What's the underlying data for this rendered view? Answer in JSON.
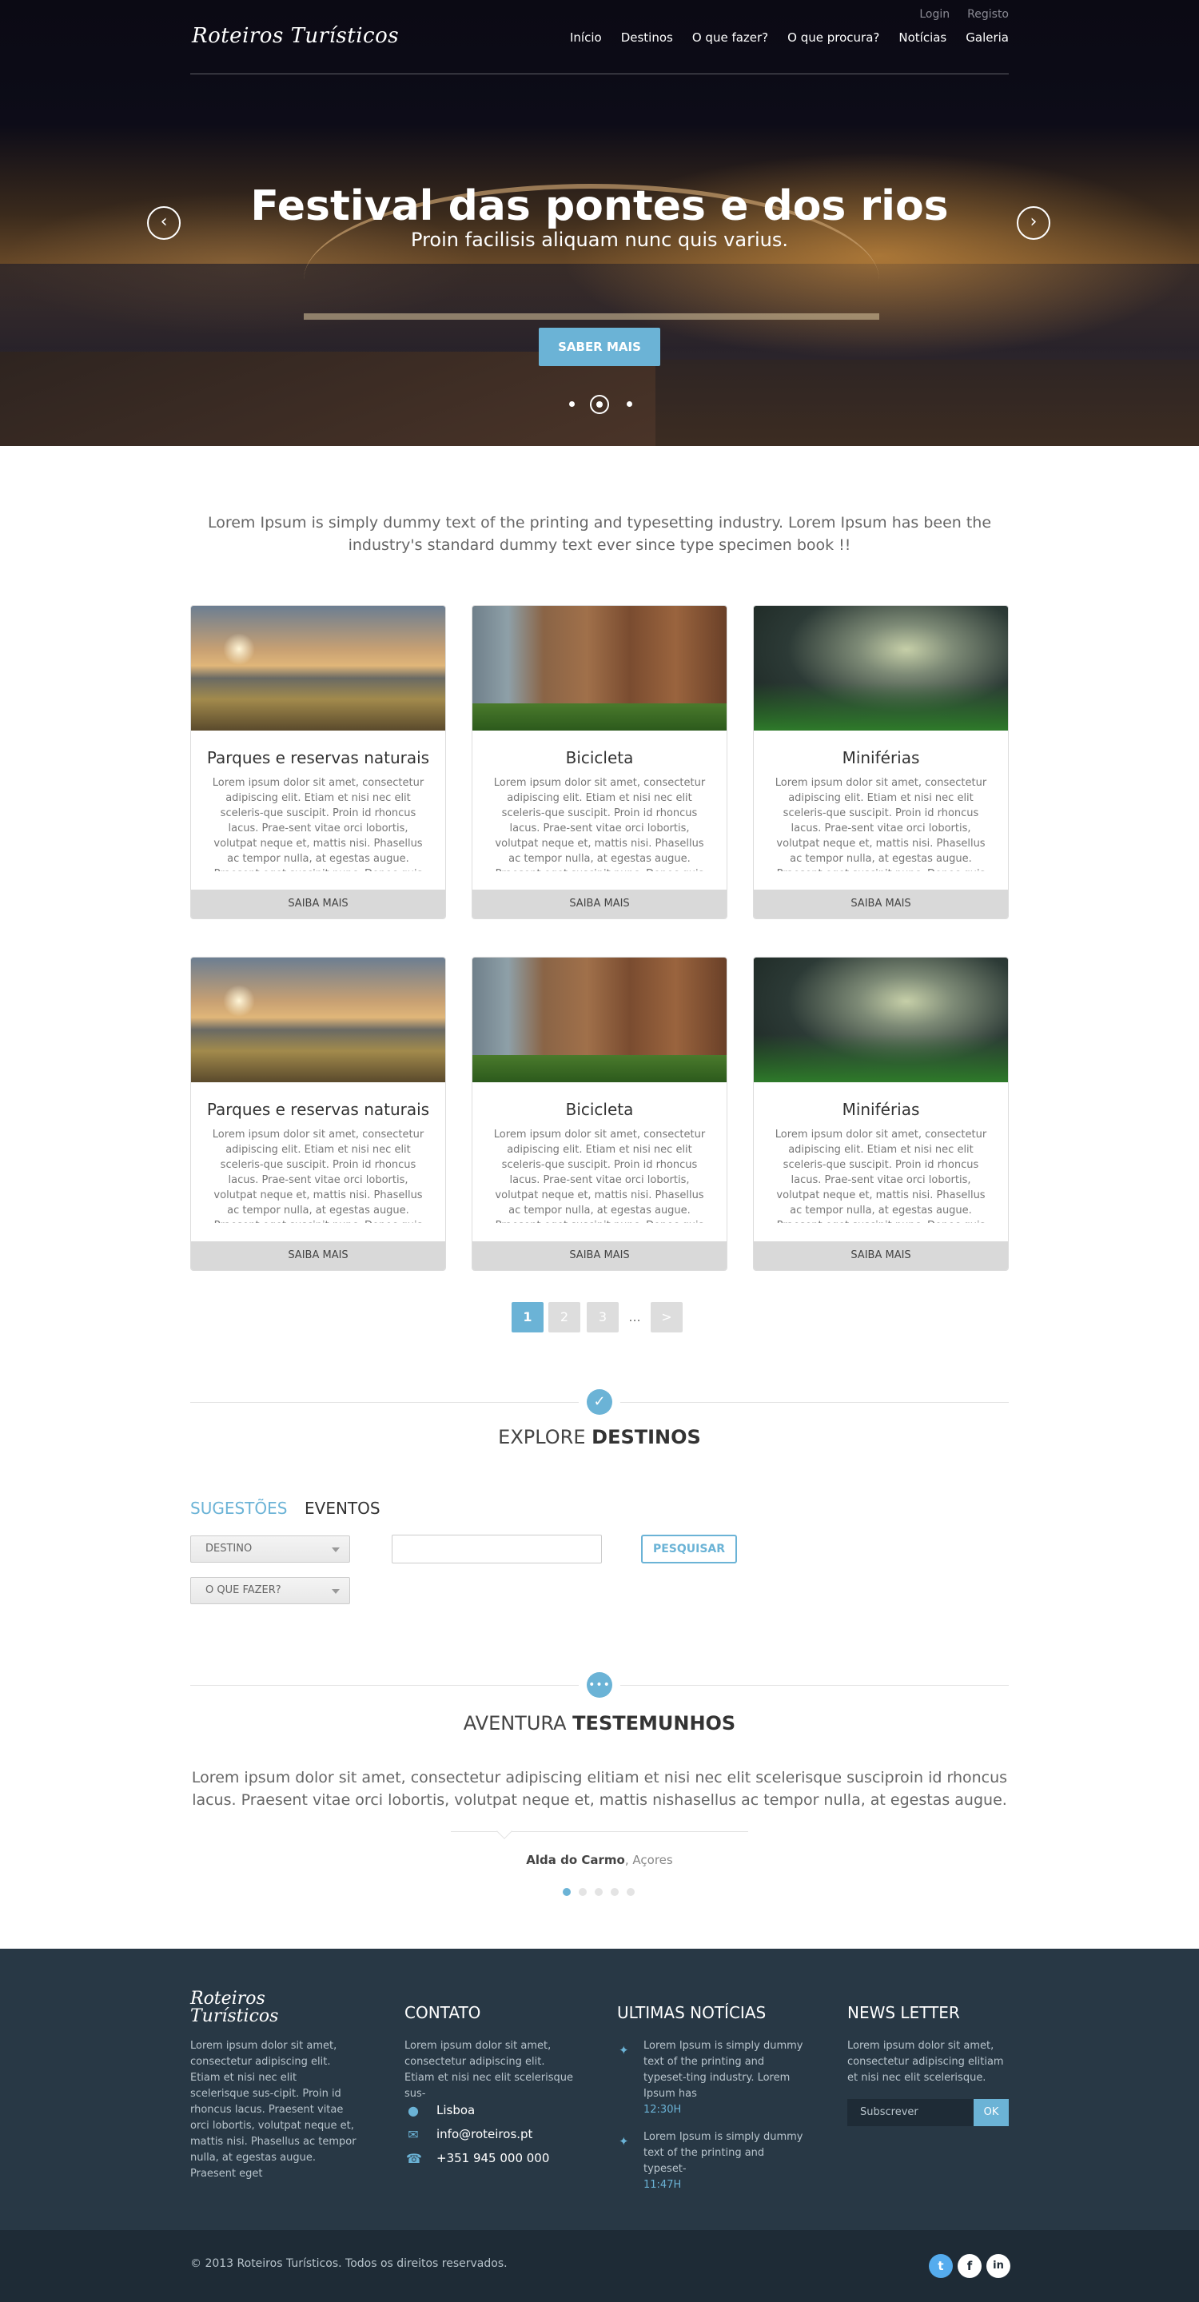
{
  "header": {
    "logo": "Roteiros Turísticos",
    "top_links": [
      "Login",
      "Registo"
    ],
    "nav": [
      "Início",
      "Destinos",
      "O que fazer?",
      "O que procura?",
      "Notícias",
      "Galeria"
    ]
  },
  "hero": {
    "title": "Festival das pontes e dos rios",
    "subtitle": "Proin facilisis aliquam nunc quis varius.",
    "button": "SABER MAIS",
    "prev_icon": "chevron-left-icon",
    "next_icon": "chevron-right-icon",
    "slide_count": 3,
    "active_slide": 2
  },
  "intro": "Lorem Ipsum is simply dummy text of the printing and typesetting industry. Lorem Ipsum has been the industry's standard dummy text ever since type specimen book !!",
  "cards": [
    {
      "title": "Parques e reservas naturais",
      "text": "Lorem ipsum dolor sit amet, consectetur adipiscing elit. Etiam et nisi nec elit sceleris-que suscipit. Proin id rhoncus lacus. Prae-sent vitae orci lobortis, volutpat neque et, mattis nisi. Phasellus ac tempor nulla, at egestas augue. Praesent eget suscipit nunc. Donec quis rhoncus sapien. Morbi euismod",
      "button": "SAIBA MAIS"
    },
    {
      "title": "Bicicleta",
      "text": "Lorem ipsum dolor sit amet, consectetur adipiscing elit. Etiam et nisi nec elit sceleris-que suscipit. Proin id rhoncus lacus. Prae-sent vitae orci lobortis, volutpat neque et, mattis nisi. Phasellus ac tempor nulla, at egestas augue. Praesent eget suscipit nunc. Donec quis rhoncus sapien. Morbi euismod",
      "button": "SAIBA MAIS"
    },
    {
      "title": "Miniférias",
      "text": "Lorem ipsum dolor sit amet, consectetur adipiscing elit. Etiam et nisi nec elit sceleris-que suscipit. Proin id rhoncus lacus. Prae-sent vitae orci lobortis, volutpat neque et, mattis nisi. Phasellus ac tempor nulla, at egestas augue. Praesent eget suscipit nunc. Donec quis rhoncus sapien. Morbi euismod",
      "button": "SAIBA MAIS"
    },
    {
      "title": "Parques e reservas naturais",
      "text": "Lorem ipsum dolor sit amet, consectetur adipiscing elit. Etiam et nisi nec elit sceleris-que suscipit. Proin id rhoncus lacus. Prae-sent vitae orci lobortis, volutpat neque et, mattis nisi. Phasellus ac tempor nulla, at egestas augue. Praesent eget suscipit nunc. Donec quis rhoncus sapien. Morbi euismod",
      "button": "SAIBA MAIS"
    },
    {
      "title": "Bicicleta",
      "text": "Lorem ipsum dolor sit amet, consectetur adipiscing elit. Etiam et nisi nec elit sceleris-que suscipit. Proin id rhoncus lacus. Prae-sent vitae orci lobortis, volutpat neque et, mattis nisi. Phasellus ac tempor nulla, at egestas augue. Praesent eget suscipit nunc. Donec quis rhoncus sapien. Morbi euismod",
      "button": "SAIBA MAIS"
    },
    {
      "title": "Miniférias",
      "text": "Lorem ipsum dolor sit amet, consectetur adipiscing elit. Etiam et nisi nec elit sceleris-que suscipit. Proin id rhoncus lacus. Prae-sent vitae orci lobortis, volutpat neque et, mattis nisi. Phasellus ac tempor nulla, at egestas augue. Praesent eget suscipit nunc. Donec quis rhoncus sapien. Morbi euismod",
      "button": "SAIBA MAIS"
    }
  ],
  "pagination": [
    "1",
    "2",
    "3",
    "...",
    ">"
  ],
  "explore": {
    "title_light": "EXPLORE",
    "title_bold": "DESTINOS",
    "icon": "checkmark-icon",
    "tabs": [
      "SUGESTÕES",
      "EVENTOS"
    ],
    "select_destino": "DESTINO",
    "select_fazer": "O QUE FAZER?",
    "search_button": "PESQUISAR",
    "search_value": ""
  },
  "testimonials": {
    "title_light": "AVENTURA",
    "title_bold": "TESTEMUNHOS",
    "icon": "speech-bubble-icon",
    "quote": "Lorem ipsum dolor sit amet, consectetur adipiscing elitiam et nisi nec elit scelerisque susciproin id rhoncus lacus. Praesent vitae orci lobortis, volutpat neque et, mattis nishasellus ac tempor nulla, at egestas augue.",
    "author_name": "Alda do Carmo",
    "author_place": ", Açores",
    "dot_count": 5,
    "active_dot": 1
  },
  "footer": {
    "logo": "Roteiros Turísticos",
    "about": "Lorem ipsum dolor sit amet, consectetur adipiscing elit. Etiam et nisi nec elit scelerisque sus-cipit. Proin id rhoncus lacus. Praesent vitae orci lobortis, volutpat neque et, mattis nisi. Phasellus ac tempor nulla, at egestas augue. Praesent eget",
    "contact_title": "CONTATO",
    "contact_text": "Lorem ipsum dolor sit amet, consectetur adipiscing elit. Etiam et nisi nec elit scelerisque sus-",
    "contact_location": "Lisboa",
    "contact_email": "info@roteiros.pt",
    "contact_phone": "+351 945 000 000",
    "news_title": "ULTIMAS NOTÍCIAS",
    "news": [
      {
        "text": "Lorem Ipsum is simply dummy text of the printing and typeset-ting industry. Lorem Ipsum has",
        "time": "12:30H"
      },
      {
        "text": "Lorem Ipsum is simply dummy text of the printing and typeset-",
        "time": "11:47H"
      }
    ],
    "newsletter_title": "NEWS LETTER",
    "newsletter_text": "Lorem ipsum dolor sit amet, consectetur adipiscing elitiam et nisi nec elit scelerisque.",
    "newsletter_placeholder": "Subscrever",
    "newsletter_button": "OK",
    "copyright": "© 2013 Roteiros Turísticos. Todos os direitos reservados.",
    "social": [
      {
        "name": "twitter-icon",
        "glyph": "t",
        "color": "#55acee"
      },
      {
        "name": "facebook-icon",
        "glyph": "f",
        "color": "#ffffff"
      },
      {
        "name": "linkedin-icon",
        "glyph": "in",
        "color": "#ffffff"
      }
    ]
  },
  "colors": {
    "accent": "#6bb3d6",
    "footer_bg": "#283845",
    "bottom_bar_bg": "#1e2b36"
  }
}
